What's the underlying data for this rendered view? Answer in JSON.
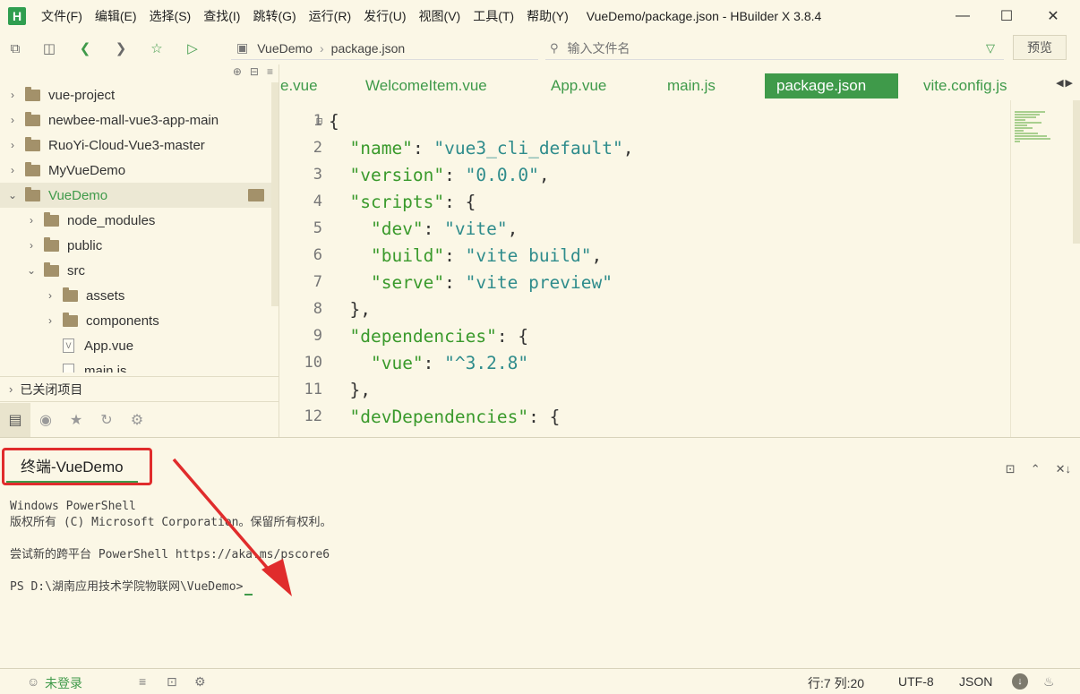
{
  "app": {
    "logo": "H",
    "window_title": "VueDemo/package.json - HBuilder X 3.8.4"
  },
  "menu": [
    "文件(F)",
    "编辑(E)",
    "选择(S)",
    "查找(I)",
    "跳转(G)",
    "运行(R)",
    "发行(U)",
    "视图(V)",
    "工具(T)",
    "帮助(Y)"
  ],
  "toolbar": {
    "breadcrumb": [
      "VueDemo",
      "package.json"
    ],
    "file_search_placeholder": "输入文件名",
    "preview_label": "预览"
  },
  "sidebar": {
    "tree": [
      {
        "label": "vue-project",
        "type": "folder",
        "state": "collapsed"
      },
      {
        "label": "newbee-mall-vue3-app-main",
        "type": "folder",
        "state": "collapsed"
      },
      {
        "label": "RuoYi-Cloud-Vue3-master",
        "type": "folder",
        "state": "collapsed"
      },
      {
        "label": "MyVueDemo",
        "type": "folder",
        "state": "collapsed"
      },
      {
        "label": "VueDemo",
        "type": "folder",
        "state": "expanded",
        "selected": true
      },
      {
        "label": "node_modules",
        "type": "folder",
        "state": "collapsed"
      },
      {
        "label": "public",
        "type": "folder",
        "state": "collapsed"
      },
      {
        "label": "src",
        "type": "folder",
        "state": "expanded"
      },
      {
        "label": "assets",
        "type": "folder",
        "state": "collapsed"
      },
      {
        "label": "components",
        "type": "folder",
        "state": "collapsed"
      },
      {
        "label": "App.vue",
        "type": "file"
      },
      {
        "label": "main.js",
        "type": "file"
      }
    ],
    "closed_projects_label": "已关闭项目"
  },
  "editor": {
    "tabs": [
      {
        "label": "e.vue",
        "active": false
      },
      {
        "label": "WelcomeItem.vue",
        "active": false
      },
      {
        "label": "App.vue",
        "active": false
      },
      {
        "label": "main.js",
        "active": false
      },
      {
        "label": "package.json",
        "active": true
      },
      {
        "label": "vite.config.js",
        "active": false
      }
    ],
    "lines": [
      {
        "n": "1",
        "fold": true,
        "t": "{"
      },
      {
        "n": "2",
        "k": "\"name\"",
        "v": "\"vue3_cli_default\"",
        "end": ",",
        "indent": 1
      },
      {
        "n": "3",
        "k": "\"version\"",
        "v": "\"0.0.0\"",
        "end": ",",
        "indent": 1
      },
      {
        "n": "4",
        "k": "\"scripts\"",
        "v": "{",
        "end": "",
        "indent": 1
      },
      {
        "n": "5",
        "k": "\"dev\"",
        "v": "\"vite\"",
        "end": ",",
        "indent": 2
      },
      {
        "n": "6",
        "k": "\"build\"",
        "v": "\"vite build\"",
        "end": ",",
        "indent": 2
      },
      {
        "n": "7",
        "k": "\"serve\"",
        "v": "\"vite preview\"",
        "end": "",
        "indent": 2
      },
      {
        "n": "8",
        "t": "},",
        "indent": 1
      },
      {
        "n": "9",
        "k": "\"dependencies\"",
        "v": "{",
        "end": "",
        "indent": 1
      },
      {
        "n": "10",
        "k": "\"vue\"",
        "v": "\"^3.2.8\"",
        "end": "",
        "indent": 2
      },
      {
        "n": "11",
        "t": "},",
        "indent": 1
      },
      {
        "n": "12",
        "k": "\"devDependencies\"",
        "v": "{",
        "end": "",
        "indent": 1
      }
    ]
  },
  "terminal": {
    "tab_label": "终端-VueDemo",
    "output": [
      "Windows PowerShell",
      "版权所有 (C) Microsoft Corporation。保留所有权利。",
      "",
      "尝试新的跨平台 PowerShell https://aka.ms/pscore6",
      "",
      "PS D:\\湖南应用技术学院物联网\\VueDemo>"
    ]
  },
  "statusbar": {
    "login": "未登录",
    "position": "行:7  列:20",
    "encoding": "UTF-8",
    "language": "JSON"
  },
  "colors": {
    "accent": "#3f9a4a",
    "background": "#fbf7e6",
    "annotation": "#e02c2c"
  }
}
